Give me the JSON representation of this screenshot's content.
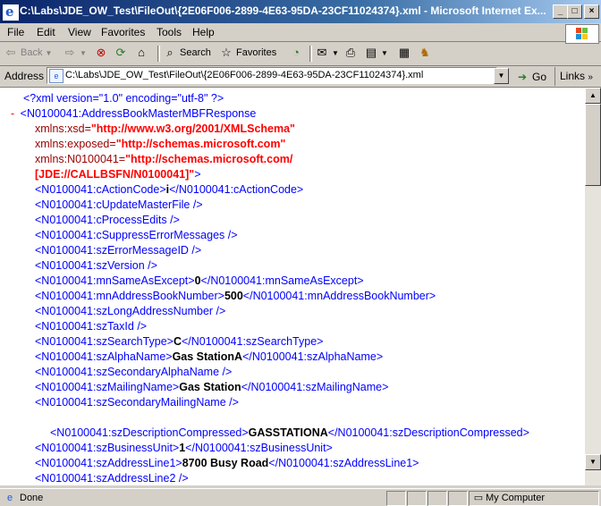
{
  "window": {
    "title": "C:\\Labs\\JDE_OW_Test\\FileOut\\{2E06F006-2899-4E63-95DA-23CF11024374}.xml - Microsoft Internet Ex...",
    "minimize_glyph": "_",
    "maximize_glyph": "□",
    "close_glyph": "×"
  },
  "menu": [
    "File",
    "Edit",
    "View",
    "Favorites",
    "Tools",
    "Help"
  ],
  "toolbar": {
    "back_label": "Back",
    "search_label": "Search",
    "favorites_label": "Favorites"
  },
  "address": {
    "label": "Address",
    "value": "C:\\Labs\\JDE_OW_Test\\FileOut\\{2E06F006-2899-4E63-95DA-23CF11024374}.xml",
    "go_label": "Go",
    "links_label": "Links"
  },
  "xml": {
    "declaration": "<?xml version=\"1.0\" encoding=\"utf-8\" ?>",
    "collapse_glyph": "-",
    "root_open": "<N0100041:AddressBookMasterMBFResponse",
    "ns_attrs": [
      {
        "name": "xmlns:xsd=",
        "value": "\"http://www.w3.org/2001/XMLSchema\""
      },
      {
        "name": "xmlns:exposed=",
        "value": "\"http://schemas.microsoft.com\""
      },
      {
        "name": "xmlns:N0100041=",
        "value": "\"http://schemas.microsoft.com/"
      }
    ],
    "ns_cont": "[JDE://CALLBSFN/N0100041]\"",
    "ns_close": ">",
    "lines": [
      {
        "open": "<N0100041:cActionCode>",
        "value": "i",
        "close": "</N0100041:cActionCode>"
      },
      {
        "open": "<N0100041:cUpdateMasterFile />",
        "value": "",
        "close": ""
      },
      {
        "open": "<N0100041:cProcessEdits />",
        "value": "",
        "close": ""
      },
      {
        "open": "<N0100041:cSuppressErrorMessages />",
        "value": "",
        "close": ""
      },
      {
        "open": "<N0100041:szErrorMessageID />",
        "value": "",
        "close": ""
      },
      {
        "open": "<N0100041:szVersion />",
        "value": "",
        "close": ""
      },
      {
        "open": "<N0100041:mnSameAsExcept>",
        "value": "0",
        "close": "</N0100041:mnSameAsExcept>"
      },
      {
        "open": "<N0100041:mnAddressBookNumber>",
        "value": "500",
        "close": "</N0100041:mnAddressBookNumber>"
      },
      {
        "open": "<N0100041:szLongAddressNumber />",
        "value": "",
        "close": ""
      },
      {
        "open": "<N0100041:szTaxId />",
        "value": "",
        "close": ""
      },
      {
        "open": "<N0100041:szSearchType>",
        "value": "C",
        "close": "</N0100041:szSearchType>"
      },
      {
        "open": "<N0100041:szAlphaName>",
        "value": "Gas StationA",
        "close": "</N0100041:szAlphaName>"
      },
      {
        "open": "<N0100041:szSecondaryAlphaName />",
        "value": "",
        "close": ""
      },
      {
        "open": "<N0100041:szMailingName>",
        "value": "Gas Station",
        "close": "</N0100041:szMailingName>"
      },
      {
        "open": "<N0100041:szSecondaryMailingName />",
        "value": "",
        "close": ""
      }
    ],
    "desc_line": {
      "open": "<N0100041:szDescriptionCompressed>",
      "value": "GASSTATIONA",
      "close": "</N0100041:szDescriptionCompressed>"
    },
    "lines2": [
      {
        "open": "<N0100041:szBusinessUnit>",
        "value": "1",
        "close": "</N0100041:szBusinessUnit>"
      },
      {
        "open": "<N0100041:szAddressLine1>",
        "value": "8700 Busy Road",
        "close": "</N0100041:szAddressLine1>"
      },
      {
        "open": "<N0100041:szAddressLine2 />",
        "value": "",
        "close": ""
      }
    ]
  },
  "status": {
    "text": "Done",
    "zone": "My Computer"
  }
}
